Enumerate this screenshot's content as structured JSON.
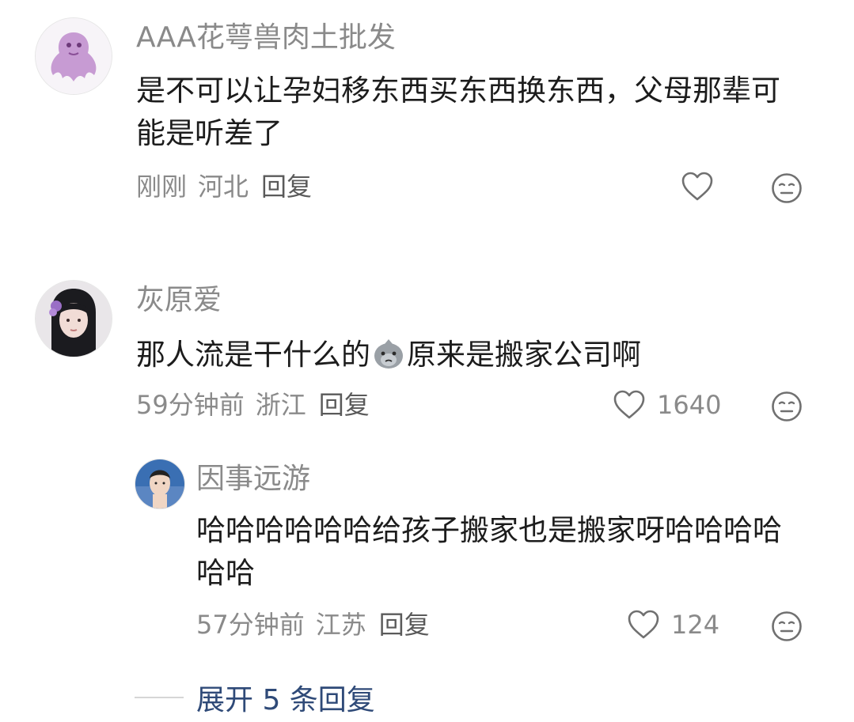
{
  "comments": [
    {
      "username": "AAA花萼兽肉土批发",
      "text": "是不可以让孕妇移东西买东西换东西，父母那辈可能是听差了",
      "time": "刚刚",
      "location": "河北",
      "reply_label": "回复",
      "likes": ""
    },
    {
      "username": "灰原爱",
      "text_before_emoji": "那人流是干什么的",
      "inline_emoji": "sad-face-emoji",
      "text_after_emoji": "原来是搬家公司啊",
      "time": "59分钟前",
      "location": "浙江",
      "reply_label": "回复",
      "likes": "1640",
      "replies": [
        {
          "username": "因事远游",
          "text": "哈哈哈哈哈哈给孩子搬家也是搬家呀哈哈哈哈哈哈",
          "time": "57分钟前",
          "location": "江苏",
          "reply_label": "回复",
          "likes": "124"
        }
      ]
    }
  ],
  "expand_replies_label": "展开 5 条回复",
  "icons": {
    "like": "heart-outline-icon",
    "reaction": "neutral-face-icon"
  },
  "colors": {
    "text_primary": "#1c1c1c",
    "text_secondary": "#8a8a8a",
    "expand_link": "#2f4a78"
  }
}
